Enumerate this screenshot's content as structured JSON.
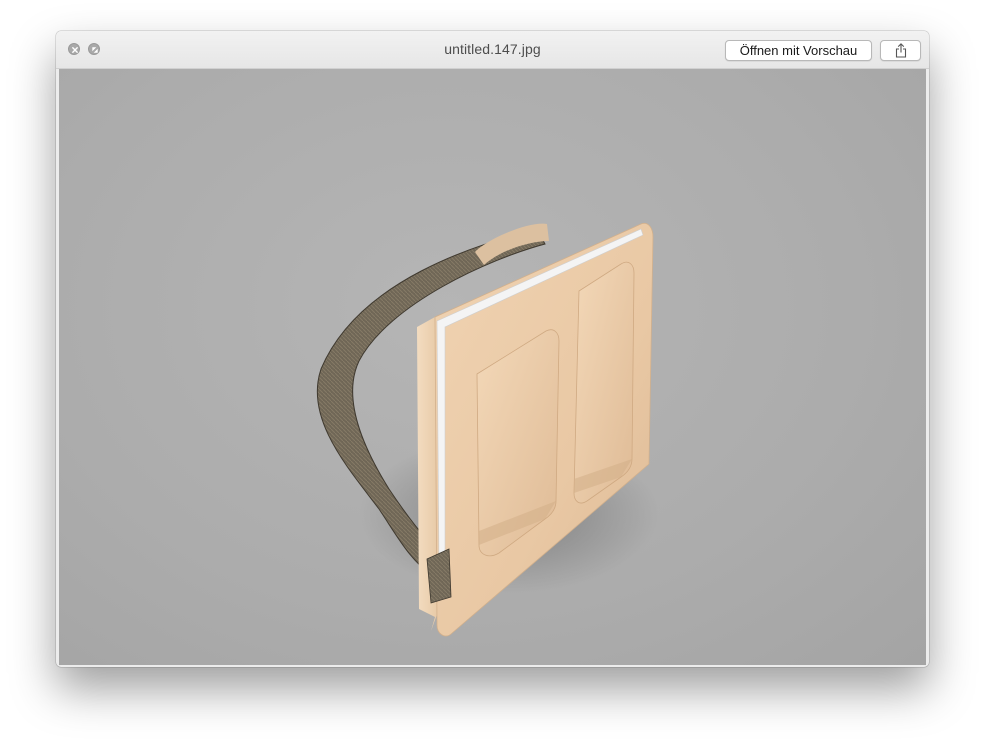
{
  "window": {
    "title": "untitled.147.jpg"
  },
  "toolbar": {
    "open_with_label": "Öffnen mit Vorschau",
    "share_icon": "share-icon"
  },
  "traffic_lights": {
    "close_icon": "close-icon",
    "fullscreen_icon": "fullscreen-icon"
  },
  "preview": {
    "subject": "3D render of a beige padded board with a woven strap on a grey background",
    "colors": {
      "background": "#b0b0b0",
      "board": "#e8c9a6",
      "strap": "#6b6252",
      "zipper": "#f2f2f2"
    }
  }
}
